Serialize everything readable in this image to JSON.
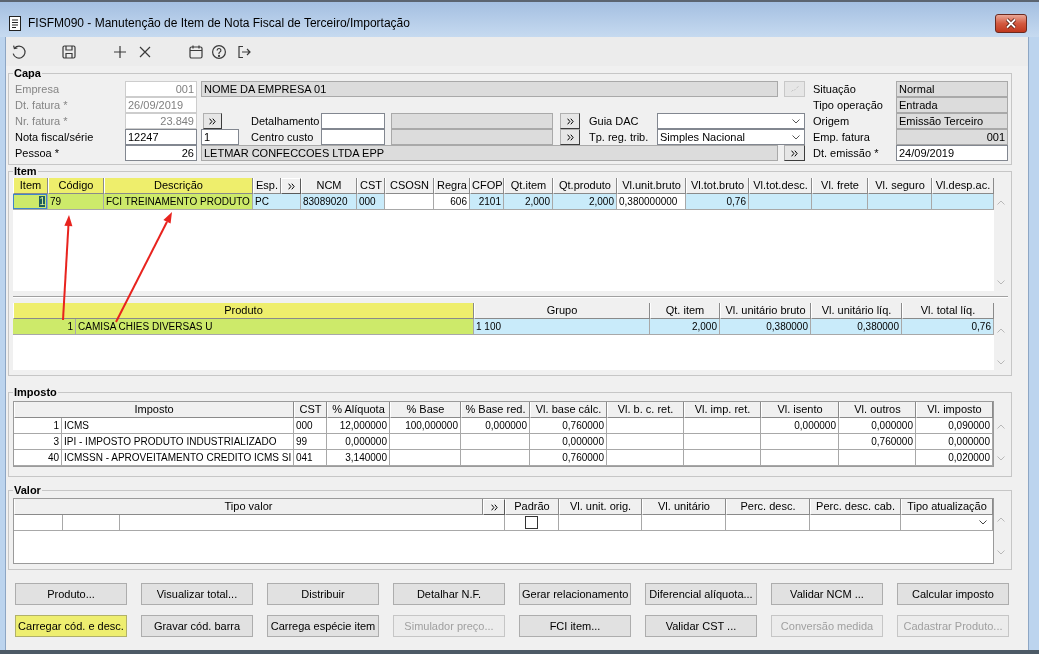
{
  "window": {
    "title": "FISFM090 - Manutenção de Item de Nota Fiscal de Terceiro/Importação"
  },
  "capa": {
    "title": "Capa",
    "empresa": {
      "label": "Empresa",
      "value": "001",
      "name": "NOME DA EMPRESA 01",
      "disabled": true
    },
    "dt_fatura": {
      "label": "Dt. fatura *",
      "value": "26/09/2019",
      "disabled": true
    },
    "nr_fatura": {
      "label": "Nr. fatura *",
      "value": "23.849",
      "disabled": true
    },
    "nota_fiscal": {
      "label": "Nota fiscal/série",
      "value": "12247",
      "serie": "1",
      "disabled": false
    },
    "pessoa": {
      "label": "Pessoa *",
      "value": "26",
      "name": "LETMAR CONFECCOES LTDA EPP",
      "disabled": false
    },
    "detalhamento": {
      "label": "Detalhamento"
    },
    "centro_custo": {
      "label": "Centro custo"
    },
    "guia_dac": {
      "label": "Guia DAC"
    },
    "tp_reg_trib": {
      "label": "Tp. reg. trib.",
      "value": "Simples Nacional"
    },
    "status": [
      {
        "label": "Situação",
        "value": "Normal",
        "disabled": true
      },
      {
        "label": "Tipo operação",
        "value": "Entrada",
        "disabled": true
      },
      {
        "label": "Origem",
        "value": "Emissão Terceiro",
        "disabled": true
      },
      {
        "label": "Emp. fatura",
        "value": "001",
        "disabled": true
      },
      {
        "label": "Dt. emissão *",
        "value": "24/09/2019",
        "disabled": false
      }
    ]
  },
  "item": {
    "title": "Item",
    "grid": {
      "columns": [
        {
          "label": "Item",
          "kind": "text",
          "highlighted": true,
          "tinted": true,
          "focused": true
        },
        {
          "label": "Código",
          "kind": "text",
          "highlighted": true,
          "tinted": true,
          "focused": false
        },
        {
          "label": "Descrição",
          "kind": "text",
          "highlighted": true,
          "tinted": true,
          "focused": false
        },
        {
          "label": "Esp.",
          "kind": "lookup",
          "highlighted": false,
          "tinted": true,
          "focused": false
        },
        {
          "label": "NCM",
          "kind": "text",
          "highlighted": false,
          "tinted": true,
          "focused": false
        },
        {
          "label": "CST",
          "kind": "text",
          "highlighted": false,
          "tinted": true,
          "focused": false
        },
        {
          "label": "CSOSN",
          "kind": "text",
          "highlighted": false,
          "tinted": false,
          "focused": false
        },
        {
          "label": "Regra",
          "kind": "text",
          "highlighted": false,
          "tinted": false,
          "focused": false
        },
        {
          "label": "CFOP",
          "kind": "text",
          "highlighted": false,
          "tinted": true,
          "focused": false
        },
        {
          "label": "Qt.item",
          "kind": "text",
          "highlighted": false,
          "tinted": true,
          "focused": false
        },
        {
          "label": "Qt.produto",
          "kind": "text",
          "highlighted": false,
          "tinted": true,
          "focused": false
        },
        {
          "label": "Vl.unit.bruto",
          "kind": "text",
          "highlighted": false,
          "tinted": false,
          "focused": false
        },
        {
          "label": "Vl.tot.bruto",
          "kind": "text",
          "highlighted": false,
          "tinted": true,
          "focused": false
        },
        {
          "label": "Vl.tot.desc.",
          "kind": "text",
          "highlighted": false,
          "tinted": true,
          "focused": false
        },
        {
          "label": "Vl. frete",
          "kind": "text",
          "highlighted": false,
          "tinted": true,
          "focused": false
        },
        {
          "label": "Vl. seguro",
          "kind": "text",
          "highlighted": false,
          "tinted": true,
          "focused": false
        },
        {
          "label": "Vl.desp.ac.",
          "kind": "text",
          "highlighted": false,
          "tinted": true,
          "focused": false
        }
      ],
      "rows": [
        [
          "1",
          "79",
          "FCI TREINAMENTO PRODUTO",
          "PC",
          "83089020",
          "000",
          null,
          "606",
          "2101",
          "2,000",
          "2,000",
          "0,380000000",
          "0,76",
          null,
          null,
          null,
          null
        ]
      ]
    },
    "products": {
      "columns": [
        {
          "label": "Produto",
          "highlighted": true
        },
        {
          "label": "Grupo",
          "highlighted": false
        },
        {
          "label": "Qt. item",
          "highlighted": false
        },
        {
          "label": "Vl. unitário bruto",
          "highlighted": false
        },
        {
          "label": "Vl. unitário líq.",
          "highlighted": false
        },
        {
          "label": "Vl. total líq.",
          "highlighted": false
        }
      ],
      "rows": [
        [
          [
            "1",
            "CAMISA CHIES DIVERSAS U"
          ],
          "1 100",
          "2,000",
          "0,380000",
          "0,380000",
          "0,76"
        ]
      ]
    }
  },
  "imposto": {
    "title": "Imposto",
    "columns": [
      "Imposto",
      "CST",
      "% Alíquota",
      "% Base",
      "% Base red.",
      "Vl. base cálc.",
      "Vl. b. c. ret.",
      "Vl. imp. ret.",
      "Vl. isento",
      "Vl. outros",
      "Vl. imposto"
    ],
    "rows": [
      [
        [
          "1",
          "ICMS"
        ],
        "000",
        "12,000000",
        "100,000000",
        "0,000000",
        "0,760000",
        null,
        null,
        "0,000000",
        "0,000000",
        "0,090000"
      ],
      [
        [
          "3",
          "IPI - IMPOSTO PRODUTO INDUSTRIALIZADO"
        ],
        "99",
        "0,000000",
        null,
        null,
        "0,000000",
        null,
        null,
        null,
        "0,760000",
        "0,000000"
      ],
      [
        [
          "40",
          "ICMSSN - APROVEITAMENTO CREDITO ICMS SI"
        ],
        "041",
        "3,140000",
        null,
        null,
        "0,760000",
        null,
        null,
        null,
        null,
        "0,020000"
      ]
    ]
  },
  "valor": {
    "title": "Valor",
    "columns": [
      {
        "label": "Tipo valor",
        "kind": "lookup"
      },
      {
        "label": "Padrão",
        "kind": "checkbox"
      },
      {
        "label": "Vl. unit. orig.",
        "kind": "text"
      },
      {
        "label": "Vl. unitário",
        "kind": "text"
      },
      {
        "label": "Perc. desc.",
        "kind": "text"
      },
      {
        "label": "Perc. desc. cab.",
        "kind": "text"
      },
      {
        "label": "Tipo atualização",
        "kind": "combo"
      }
    ],
    "rows": [
      {
        "checked": false
      }
    ]
  },
  "buttons": [
    [
      {
        "label": "Produto...",
        "disabled": false,
        "highlighted": false
      },
      {
        "label": "Visualizar total...",
        "disabled": false,
        "highlighted": false
      },
      {
        "label": "Distribuir",
        "disabled": false,
        "highlighted": false
      },
      {
        "label": "Detalhar N.F.",
        "disabled": false,
        "highlighted": false
      },
      {
        "label": "Gerar relacionamento",
        "disabled": false,
        "highlighted": false
      },
      {
        "label": "Diferencial alíquota...",
        "disabled": false,
        "highlighted": false
      },
      {
        "label": "Validar NCM ...",
        "disabled": false,
        "highlighted": false
      },
      {
        "label": "Calcular imposto",
        "disabled": false,
        "highlighted": false
      }
    ],
    [
      {
        "label": "Carregar cód. e desc.",
        "disabled": false,
        "highlighted": true
      },
      {
        "label": "Gravar cód. barra",
        "disabled": false,
        "highlighted": false
      },
      {
        "label": "Carrega espécie item",
        "disabled": false,
        "highlighted": false
      },
      {
        "label": "Simulador preço...",
        "disabled": true,
        "highlighted": false
      },
      {
        "label": "FCI item...",
        "disabled": false,
        "highlighted": false
      },
      {
        "label": "Validar CST ...",
        "disabled": false,
        "highlighted": false
      },
      {
        "label": "Conversão medida",
        "disabled": true,
        "highlighted": false
      },
      {
        "label": "Cadastrar Produto...",
        "disabled": true,
        "highlighted": false
      }
    ]
  ]
}
